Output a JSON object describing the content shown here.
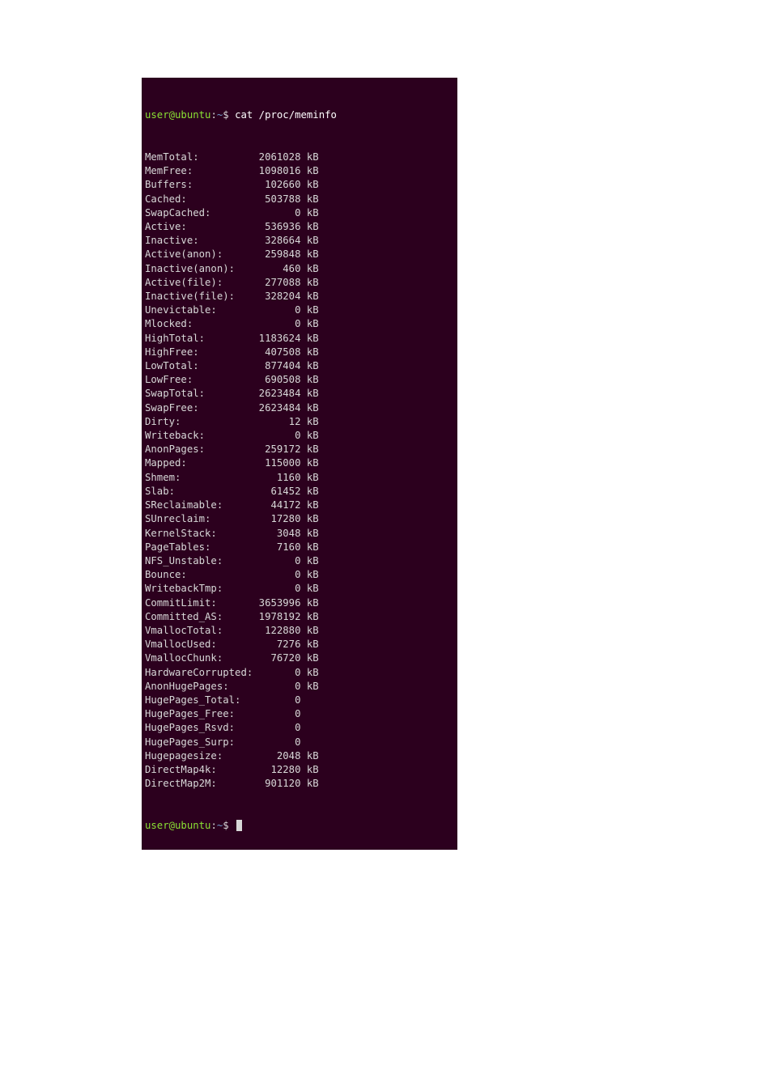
{
  "prompt": {
    "user_host": "user@ubuntu",
    "separator1": ":",
    "path": "~",
    "symbol": "$ ",
    "command": "cat /proc/meminfo"
  },
  "meminfo": [
    {
      "label": "MemTotal:",
      "value": "2061028",
      "unit": "kB"
    },
    {
      "label": "MemFree:",
      "value": "1098016",
      "unit": "kB"
    },
    {
      "label": "Buffers:",
      "value": "102660",
      "unit": "kB"
    },
    {
      "label": "Cached:",
      "value": "503788",
      "unit": "kB"
    },
    {
      "label": "SwapCached:",
      "value": "0",
      "unit": "kB"
    },
    {
      "label": "Active:",
      "value": "536936",
      "unit": "kB"
    },
    {
      "label": "Inactive:",
      "value": "328664",
      "unit": "kB"
    },
    {
      "label": "Active(anon):",
      "value": "259848",
      "unit": "kB"
    },
    {
      "label": "Inactive(anon):",
      "value": "460",
      "unit": "kB"
    },
    {
      "label": "Active(file):",
      "value": "277088",
      "unit": "kB"
    },
    {
      "label": "Inactive(file):",
      "value": "328204",
      "unit": "kB"
    },
    {
      "label": "Unevictable:",
      "value": "0",
      "unit": "kB"
    },
    {
      "label": "Mlocked:",
      "value": "0",
      "unit": "kB"
    },
    {
      "label": "HighTotal:",
      "value": "1183624",
      "unit": "kB"
    },
    {
      "label": "HighFree:",
      "value": "407508",
      "unit": "kB"
    },
    {
      "label": "LowTotal:",
      "value": "877404",
      "unit": "kB"
    },
    {
      "label": "LowFree:",
      "value": "690508",
      "unit": "kB"
    },
    {
      "label": "SwapTotal:",
      "value": "2623484",
      "unit": "kB"
    },
    {
      "label": "SwapFree:",
      "value": "2623484",
      "unit": "kB"
    },
    {
      "label": "Dirty:",
      "value": "12",
      "unit": "kB"
    },
    {
      "label": "Writeback:",
      "value": "0",
      "unit": "kB"
    },
    {
      "label": "AnonPages:",
      "value": "259172",
      "unit": "kB"
    },
    {
      "label": "Mapped:",
      "value": "115000",
      "unit": "kB"
    },
    {
      "label": "Shmem:",
      "value": "1160",
      "unit": "kB"
    },
    {
      "label": "Slab:",
      "value": "61452",
      "unit": "kB"
    },
    {
      "label": "SReclaimable:",
      "value": "44172",
      "unit": "kB"
    },
    {
      "label": "SUnreclaim:",
      "value": "17280",
      "unit": "kB"
    },
    {
      "label": "KernelStack:",
      "value": "3048",
      "unit": "kB"
    },
    {
      "label": "PageTables:",
      "value": "7160",
      "unit": "kB"
    },
    {
      "label": "NFS_Unstable:",
      "value": "0",
      "unit": "kB"
    },
    {
      "label": "Bounce:",
      "value": "0",
      "unit": "kB"
    },
    {
      "label": "WritebackTmp:",
      "value": "0",
      "unit": "kB"
    },
    {
      "label": "CommitLimit:",
      "value": "3653996",
      "unit": "kB"
    },
    {
      "label": "Committed_AS:",
      "value": "1978192",
      "unit": "kB"
    },
    {
      "label": "VmallocTotal:",
      "value": "122880",
      "unit": "kB"
    },
    {
      "label": "VmallocUsed:",
      "value": "7276",
      "unit": "kB"
    },
    {
      "label": "VmallocChunk:",
      "value": "76720",
      "unit": "kB"
    },
    {
      "label": "HardwareCorrupted:",
      "value": "0",
      "unit": "kB"
    },
    {
      "label": "AnonHugePages:",
      "value": "0",
      "unit": "kB"
    },
    {
      "label": "HugePages_Total:",
      "value": "0",
      "unit": ""
    },
    {
      "label": "HugePages_Free:",
      "value": "0",
      "unit": ""
    },
    {
      "label": "HugePages_Rsvd:",
      "value": "0",
      "unit": ""
    },
    {
      "label": "HugePages_Surp:",
      "value": "0",
      "unit": ""
    },
    {
      "label": "Hugepagesize:",
      "value": "2048",
      "unit": "kB"
    },
    {
      "label": "DirectMap4k:",
      "value": "12280",
      "unit": "kB"
    },
    {
      "label": "DirectMap2M:",
      "value": "901120",
      "unit": "kB"
    }
  ],
  "prompt2": {
    "user_host": "user@ubuntu",
    "separator1": ":",
    "path": "~",
    "symbol": "$ "
  },
  "layout": {
    "label_chars": 18,
    "value_chars": 8
  }
}
